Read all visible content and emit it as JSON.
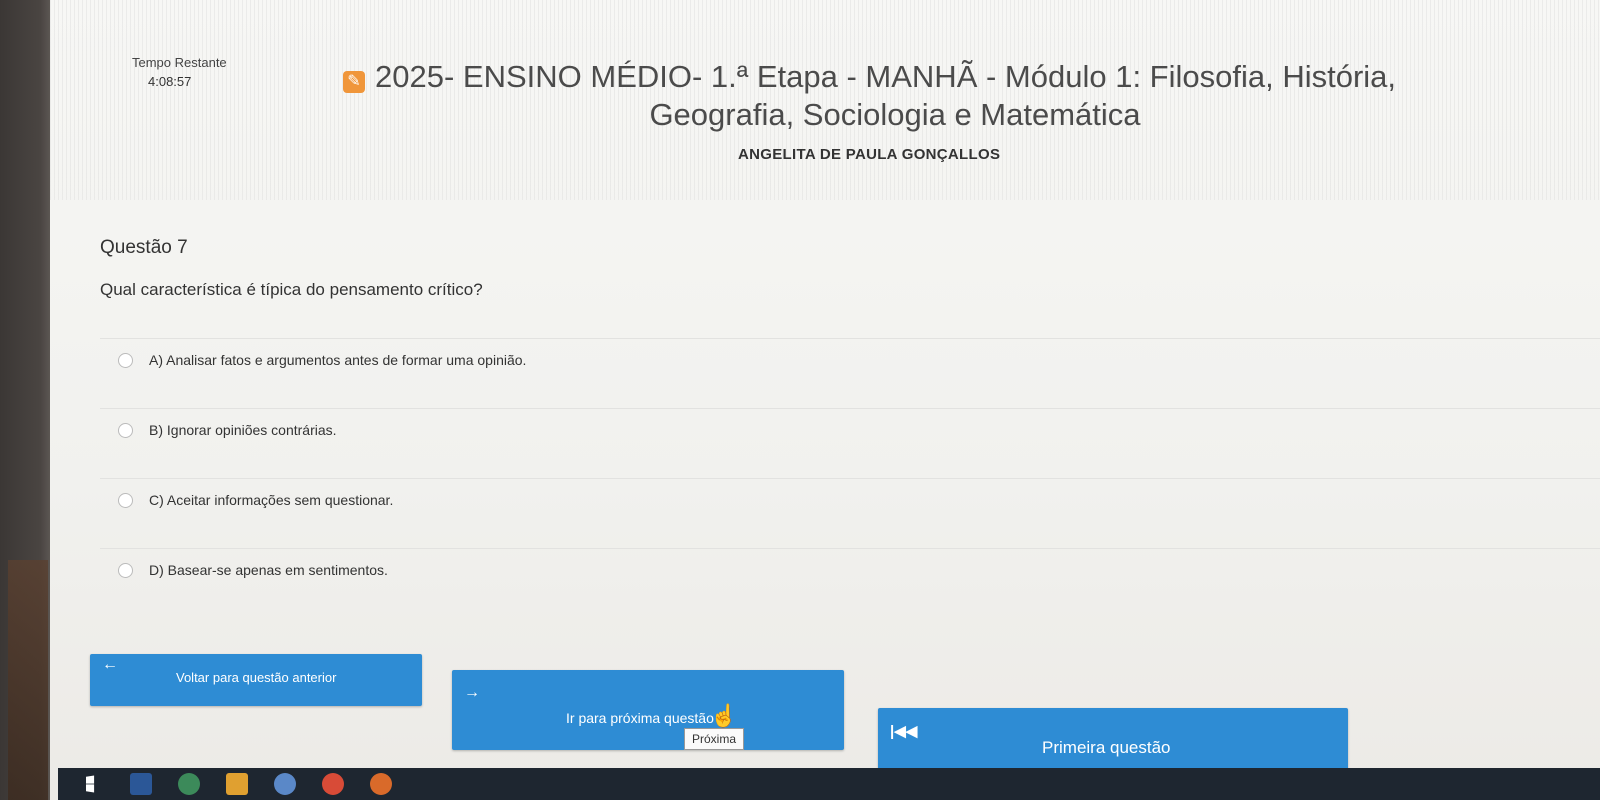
{
  "timer": {
    "label": "Tempo Restante",
    "value": "4:08:57"
  },
  "exam": {
    "title_line1": "2025- ENSINO MÉDIO- 1.ª Etapa - MANHÃ - Módulo 1: Filosofia, História,",
    "title_line2": "Geografia, Sociologia e Matemática",
    "student_name": "ANGELITA DE PAULA GONÇALLOS"
  },
  "question": {
    "number": "Questão 7",
    "text": "Qual característica é típica do pensamento crítico?",
    "options": [
      {
        "label": "A) Analisar fatos e argumentos antes de formar uma opinião."
      },
      {
        "label": "B) Ignorar opiniões contrárias."
      },
      {
        "label": "C) Aceitar informações sem questionar."
      },
      {
        "label": "D) Basear-se apenas em sentimentos."
      }
    ]
  },
  "nav": {
    "prev_label": "Voltar para questão anterior",
    "next_label": "Ir para próxima questão",
    "next_tooltip": "Próxima",
    "first_label": "Primeira questão"
  },
  "icons": {
    "edit": "edit-icon",
    "prev": "arrow-left-icon",
    "next": "arrow-right-icon",
    "first": "skip-first-icon"
  },
  "colors": {
    "button": "#2e8cd4",
    "edit_icon": "#f0963a"
  }
}
